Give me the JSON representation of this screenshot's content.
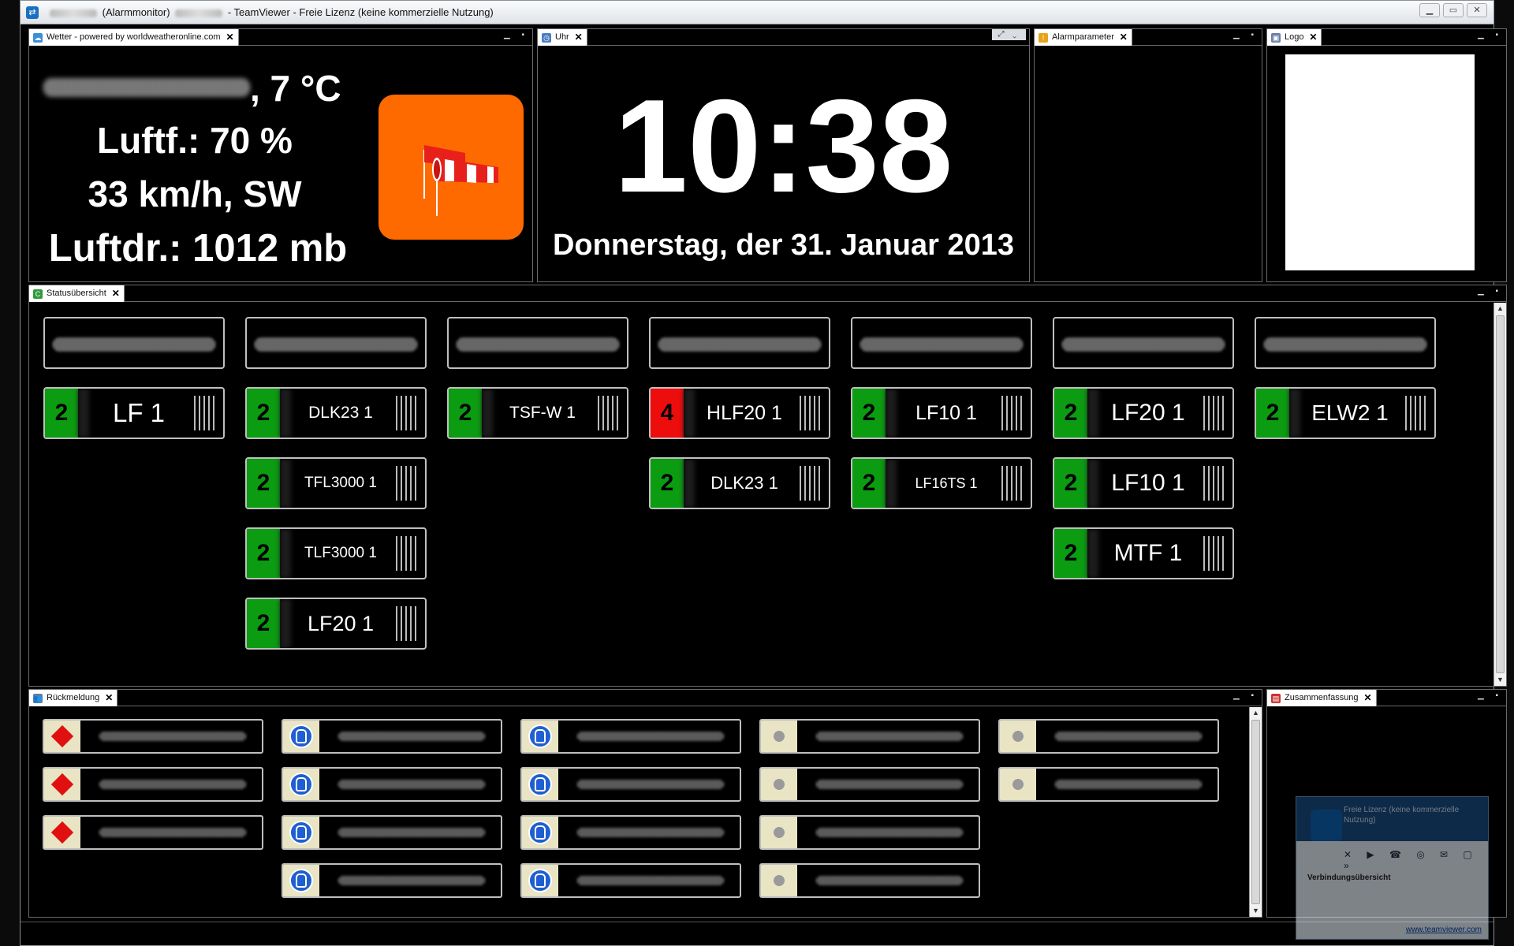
{
  "window": {
    "title_prefix": "(Alarmmonitor)",
    "title_suffix": "- TeamViewer - Freie Lizenz (keine kommerzielle Nutzung)"
  },
  "weather": {
    "tab_label": "Wetter - powered by worldweatheronline.com",
    "temperature": ", 7 °C",
    "humidity": "Luftf.: 70 %",
    "wind": "33 km/h, SW",
    "pressure": "Luftdr.: 1012 mb"
  },
  "clock": {
    "tab_label": "Uhr",
    "time": "10:38",
    "date": "Donnerstag, der 31. Januar 2013"
  },
  "alarm": {
    "tab_label": "Alarmparameter"
  },
  "logo": {
    "tab_label": "Logo"
  },
  "status": {
    "tab_label": "Statusübersicht",
    "colors": {
      "status_2": "#0c9c12",
      "status_4": "#ee0d0d"
    },
    "vehicles": [
      {
        "status": "2",
        "name": "LF 1"
      },
      {
        "status": "2",
        "name": "DLK23 1"
      },
      {
        "status": "2",
        "name": "TFL3000 1"
      },
      {
        "status": "2",
        "name": "TLF3000 1"
      },
      {
        "status": "2",
        "name": "LF20 1"
      },
      {
        "status": "2",
        "name": "TSF-W 1"
      },
      {
        "status": "4",
        "name": "HLF20 1"
      },
      {
        "status": "2",
        "name": "DLK23 1"
      },
      {
        "status": "2",
        "name": "LF10 1"
      },
      {
        "status": "2",
        "name": "LF16TS 1"
      },
      {
        "status": "2",
        "name": "LF20 1"
      },
      {
        "status": "2",
        "name": "LF10 1"
      },
      {
        "status": "2",
        "name": "MTF 1"
      },
      {
        "status": "2",
        "name": "ELW2 1"
      }
    ]
  },
  "feedback": {
    "tab_label": "Rückmeldung"
  },
  "summary": {
    "tab_label": "Zusammenfassung"
  },
  "teamviewer": {
    "text": "Freie Lizenz (keine kommerzielle Nutzung)",
    "section": "Verbindungsübersicht",
    "link": "www.teamviewer.com"
  }
}
